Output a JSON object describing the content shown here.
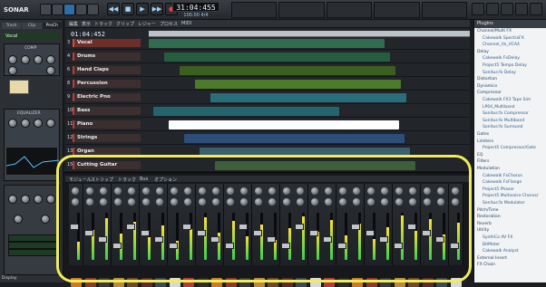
{
  "app": {
    "title": "SONAR X1"
  },
  "transport": {
    "time": "31:04:455",
    "tempo": "100.00",
    "meter": "4/4",
    "buttons": [
      "rewind",
      "stop",
      "play",
      "forward",
      "record"
    ]
  },
  "inspector": {
    "tabs": [
      "Track",
      "Clip",
      "ProCh"
    ],
    "track_label": "Vocal",
    "comp_label": "COMP",
    "eq_label": "EQUALIZER",
    "display_label": "Display"
  },
  "trackview": {
    "menu": [
      "編集",
      "表示",
      "トラック",
      "クリップ",
      "レジャー",
      "プロセス",
      "MIDI"
    ],
    "counter": "01:04:452",
    "tracks": [
      {
        "num": "3",
        "name": "Vocal",
        "color": "#d94b3b"
      },
      {
        "num": "4",
        "name": "Drums",
        "color": "#c23b2f"
      },
      {
        "num": "6",
        "name": "Hand Claps",
        "color": "#c23b2f"
      },
      {
        "num": "8",
        "name": "Percussion",
        "color": "#c23b2f"
      },
      {
        "num": "9",
        "name": "Electric Pno",
        "color": "#c23b2f"
      },
      {
        "num": "10",
        "name": "Bass",
        "color": "#c23b2f"
      },
      {
        "num": "11",
        "name": "Piano",
        "color": "#c23b2f"
      },
      {
        "num": "12",
        "name": "Strings",
        "color": "#c23b2f"
      },
      {
        "num": "13",
        "name": "Organ",
        "color": "#c23b2f"
      },
      {
        "num": "15",
        "name": "Cutting Guitar",
        "color": "#c23b2f"
      }
    ]
  },
  "console": {
    "menu": [
      "モジュール",
      "ストリップ",
      "トラック",
      "Bus",
      "オプション"
    ]
  },
  "browser": {
    "title": "Plugins",
    "items": [
      "Channel/Multi FX",
      "Cakewalk SpectraFX",
      "Channel_Vx_VCA4",
      "Delay",
      "Cakewalk FxDelay",
      "Project5 Tempo Delay",
      "Sonitus:fx Delay",
      "Distortion",
      "Dynamics",
      "Compressor",
      "Cakewalk FX3 Tape Sim",
      "LP64_Multiband",
      "Sonitus:fx Compressor",
      "Sonitus:fx Multiband",
      "Sonitus:fx Surround",
      "Gates",
      "Limiters",
      "Project5 Compressor/Gate",
      "EQ",
      "Filters",
      "Modulation",
      "Cakewalk FxChorus",
      "Cakewalk FxFlange",
      "Project5 Phaser",
      "Project5 Multivoice Chorus/",
      "Sonitus:fx Modulator",
      "Pitch/Time",
      "Restoration",
      "Reverb",
      "Utility",
      "SynthCo AV FX",
      "BitMeter",
      "Cakewalk Analyst",
      "External Insert",
      "FX Chain"
    ]
  },
  "status": {
    "label": "Display"
  }
}
